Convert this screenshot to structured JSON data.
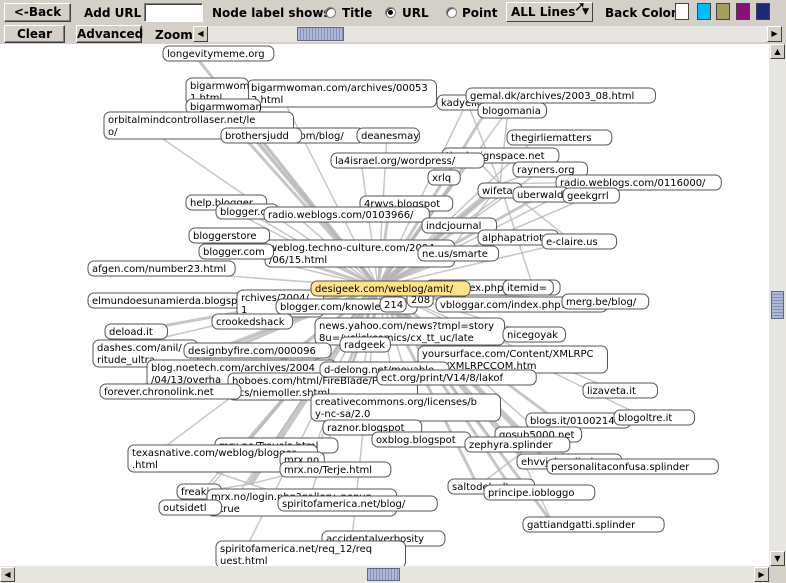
{
  "toolbar": {
    "back_label": "<-Back",
    "add_url_label": "Add URL",
    "add_url_value": "",
    "node_label_shows": "Node label shows:",
    "radio_title": "Title",
    "radio_url": "URL",
    "radio_point": "Point",
    "selected_label_mode": "URL",
    "lines_select": "ALL Lines",
    "back_color_label": "Back Color:",
    "back_colors": [
      "#ffffff",
      "#00bcff",
      "#a59f5e",
      "#8b0f7a",
      "#1a2a78"
    ],
    "clear_label": "Clear",
    "advanced_label": "Advanced",
    "zoom_label": "Zoom"
  },
  "graph": {
    "hub": "desigeek.com/weblog/amit/",
    "nodes": [
      {
        "lines": [
          "longevitymeme.org"
        ]
      },
      {
        "lines": [
          "bigarmwoman.com/archives/00053",
          "3.html"
        ]
      },
      {
        "lines": [
          "bigarmwom",
          "1.html"
        ]
      },
      {
        "lines": [
          "bigarmwoman"
        ]
      },
      {
        "lines": [
          "orbitalmindcontrollaser.net/le",
          "o/"
        ]
      },
      {
        "lines": [
          "brothersjudd.com/blog/"
        ]
      },
      {
        "lines": [
          "brothersjudd"
        ]
      },
      {
        "lines": [
          "deanesmay"
        ]
      },
      {
        "lines": [
          "kadyellebee"
        ]
      },
      {
        "lines": [
          "gemal.dk/archives/2003_08.html"
        ]
      },
      {
        "lines": [
          "blogomania"
        ]
      },
      {
        "lines": [
          "thegirliematters"
        ]
      },
      {
        "lines": [
          "thedesignspace.net"
        ]
      },
      {
        "lines": [
          "la4israel.org/wordpress/"
        ]
      },
      {
        "lines": [
          "rayners.org"
        ]
      },
      {
        "lines": [
          "xrlq"
        ]
      },
      {
        "lines": [
          "radio.weblogs.com/0116000/"
        ]
      },
      {
        "lines": [
          "wifeta"
        ]
      },
      {
        "lines": [
          "uberwald"
        ]
      },
      {
        "lines": [
          "geekgrrl"
        ]
      },
      {
        "lines": [
          "help.blogger"
        ]
      },
      {
        "lines": [
          "4rwvs.blogspot"
        ]
      },
      {
        "lines": [
          "blogger.c"
        ]
      },
      {
        "lines": [
          "radio.weblogs.com/0103966/"
        ]
      },
      {
        "lines": [
          "indcjournal"
        ]
      },
      {
        "lines": [
          "alphapatriot"
        ]
      },
      {
        "lines": [
          "e-claire.us"
        ]
      },
      {
        "lines": [
          "bloggerstore"
        ]
      },
      {
        "lines": [
          "weblog.techno-culture.com/2004",
          "/06/15.html"
        ]
      },
      {
        "lines": [
          "blogger.com"
        ]
      },
      {
        "lines": [
          "ne.us/smarte"
        ]
      },
      {
        "lines": [
          "afgen.com/number23.html"
        ]
      },
      {
        "lines": [
          "elmundoesunamierda.blogspot"
        ]
      },
      {
        "lines": [
          "com/index.php?itemid="
        ]
      },
      {
        "lines": [
          "rchives/2004/",
          "1"
        ]
      },
      {
        "lines": [
          "blogger.com/knowledge/"
        ]
      },
      {
        "lines": [
          "vbloggar.com/index.php?item"
        ]
      },
      {
        "lines": [
          "merg.be/blog/"
        ]
      },
      {
        "lines": [
          "crookedshack"
        ]
      },
      {
        "lines": [
          "deload.it"
        ]
      },
      {
        "lines": [
          "dashes.com/anil/",
          "ritude_ultra"
        ]
      },
      {
        "lines": [
          "news.yahoo.com/news?tmpl=story",
          "8u=/uclickcomics/cx_tt_uc/late"
        ]
      },
      {
        "lines": [
          "designbyfire.com/000096"
        ]
      },
      {
        "lines": [
          "blog.noetech.com/archives/2004",
          "/04/13/overha"
        ]
      },
      {
        "lines": [
          "yoursurface.com/Content/XMLRPC",
          "COM/XMLRPCCOM.htm"
        ]
      },
      {
        "lines": [
          "hoboes.com/html/FireBlade/Poli",
          "tics/niemoller.shtml"
        ]
      },
      {
        "lines": [
          "d-delong.net/movable"
        ]
      },
      {
        "lines": [
          "ect.org/print/V14/8/lakof"
        ]
      },
      {
        "lines": [
          "forever.chronolink.net"
        ]
      },
      {
        "lines": [
          "lizaveta.it"
        ]
      },
      {
        "lines": [
          "creativecommons.org/licenses/b",
          "y-nc-sa/2.0"
        ]
      },
      {
        "lines": [
          "blogs.it/0100214"
        ]
      },
      {
        "lines": [
          "blogoltre.it"
        ]
      },
      {
        "lines": [
          "raznor.blogspot"
        ]
      },
      {
        "lines": [
          "qosub5000.net"
        ]
      },
      {
        "lines": [
          "oxblog.blogspot"
        ]
      },
      {
        "lines": [
          "zephyra.splinder"
        ]
      },
      {
        "lines": [
          "mrx.no/Travels.html"
        ]
      },
      {
        "lines": [
          "texasnative.com/weblog/blogger",
          ".html"
        ]
      },
      {
        "lines": [
          "mrx.no"
        ]
      },
      {
        "lines": [
          "ehvvjeinsplinder"
        ]
      },
      {
        "lines": [
          "personalitaconfusa.splinder"
        ]
      },
      {
        "lines": [
          "mrx.no/Terje.html"
        ]
      },
      {
        "lines": [
          "saltodelsalto"
        ]
      },
      {
        "lines": [
          "freaki"
        ]
      },
      {
        "lines": [
          "mrx.no/login.php?gallery_popup",
          "=true"
        ]
      },
      {
        "lines": [
          "principe.iobloggo"
        ]
      },
      {
        "lines": [
          "outsidetl"
        ]
      },
      {
        "lines": [
          "spiritofamerica.net/blog/"
        ]
      },
      {
        "lines": [
          "gattiandgatti.splinder"
        ]
      },
      {
        "lines": [
          "accidentalverbosity"
        ]
      },
      {
        "lines": [
          "spiritofamerica.net/req_12/req",
          "uest.html"
        ]
      },
      {
        "lines": [
          "itemid="
        ]
      },
      {
        "lines": [
          "nicegoyak"
        ]
      },
      {
        "lines": [
          "radgeek"
        ]
      },
      {
        "lines": [
          "208"
        ]
      },
      {
        "lines": [
          "214"
        ]
      }
    ]
  }
}
